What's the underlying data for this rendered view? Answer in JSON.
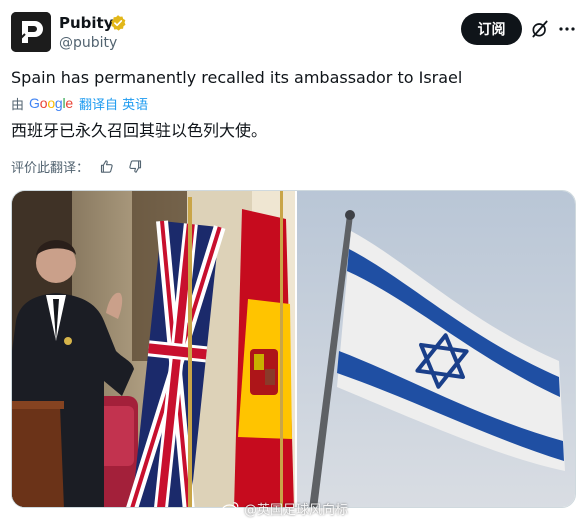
{
  "author": {
    "name": "Pubity",
    "handle": "@pubity",
    "verified": true
  },
  "header": {
    "subscribe_label": "订阅"
  },
  "tweet": {
    "text": "Spain has permanently recalled its ambassador to Israel"
  },
  "translation": {
    "by_label": "由",
    "provider": "Google",
    "link_label": "翻译自 英语",
    "text": "西班牙已永久召回其驻以色列大使。"
  },
  "rating": {
    "label": "评价此翻译："
  },
  "watermark": {
    "text": "@英国足球风向标"
  },
  "icons": {
    "verified": "verified-badge-icon",
    "grok": "grok-icon",
    "more": "more-icon",
    "thumbs_up": "thumbs-up-icon",
    "thumbs_down": "thumbs-down-icon",
    "weibo": "weibo-icon"
  },
  "colors": {
    "subscribe_bg": "#0f1419",
    "link": "#1d9bf0",
    "secondary_text": "#536471",
    "verified_gold": "#e2b719"
  }
}
